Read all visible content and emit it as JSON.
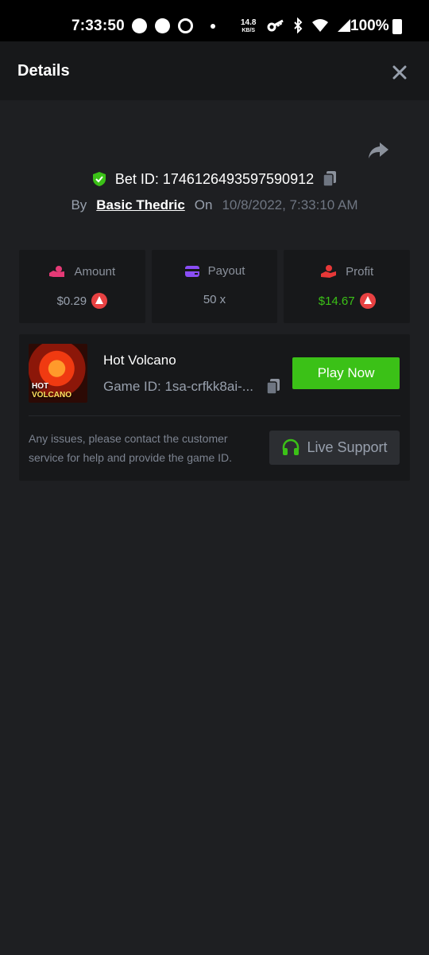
{
  "status_bar": {
    "time": "7:33:50",
    "net_speed_value": "14.8",
    "net_speed_unit": "KB/S",
    "battery": "100%"
  },
  "header": {
    "title": "Details"
  },
  "bet": {
    "id_label": "Bet ID: 1746126493597590912",
    "by_label": "By",
    "user": "Basic Thedric",
    "on_label": "On",
    "date": "10/8/2022, 7:33:10 AM"
  },
  "stats": {
    "amount": {
      "label": "Amount",
      "value": "$0.29"
    },
    "payout": {
      "label": "Payout",
      "value": "50 x"
    },
    "profit": {
      "label": "Profit",
      "value": "$14.67"
    }
  },
  "game": {
    "name": "Hot Volcano",
    "id": "Game ID: 1sa-crfkk8ai-...",
    "play_label": "Play Now",
    "thumb_title_1": "HOT",
    "thumb_title_2": "VOLCANO",
    "help_text": "Any issues, please contact the customer service for help and provide the game ID.",
    "support_label": "Live Support"
  },
  "colors": {
    "accent_green": "#3bc117",
    "profit_green": "#3bc117",
    "coin_red": "#e84142",
    "background": "#1e1f22",
    "card": "#17181a"
  },
  "icons": {
    "shield": "shield-check-icon",
    "copy": "copy-icon",
    "share": "share-icon",
    "close": "close-icon",
    "amount": "hand-coins-icon",
    "payout": "wallet-icon",
    "profit": "hand-money-icon",
    "headset": "headset-icon",
    "coin": "avax-coin-icon"
  }
}
